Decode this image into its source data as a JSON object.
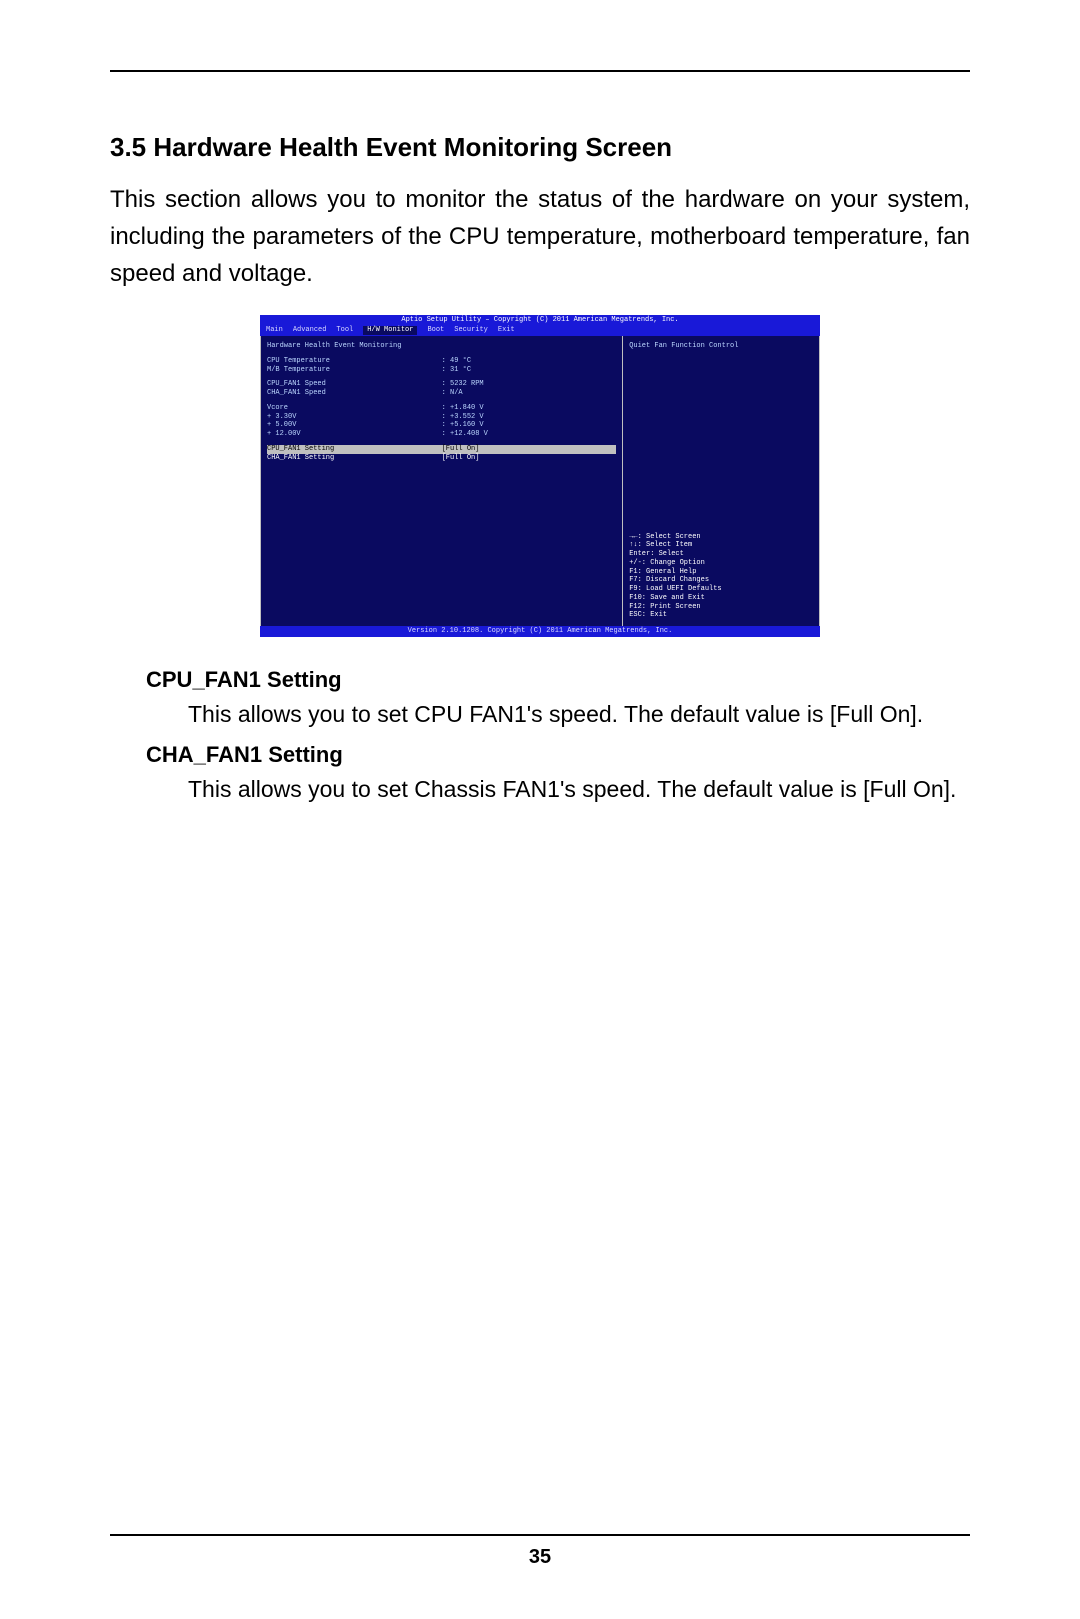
{
  "section_title": "3.5  Hardware Health Event Monitoring Screen",
  "intro": "This section allows you to monitor the status of the hardware on your system, including the parameters of the CPU temperature, motherboard temperature, fan speed and voltage.",
  "page_number": "35",
  "bios": {
    "titlebar": "Aptio Setup Utility – Copyright (C) 2011 American Megatrends, Inc.",
    "menus": [
      "Main",
      "Advanced",
      "Tool",
      "H/W Monitor",
      "Boot",
      "Security",
      "Exit"
    ],
    "menu_active_index": 3,
    "screen_header": "Hardware Health Event Monitoring",
    "rows": [
      {
        "label": "CPU Temperature",
        "value": ": 49 °C"
      },
      {
        "label": "M/B Temperature",
        "value": ": 31 °C"
      },
      {
        "gap": true
      },
      {
        "label": "CPU_FAN1 Speed",
        "value": ": 5232 RPM"
      },
      {
        "label": "CHA_FAN1 Speed",
        "value": ": N/A"
      },
      {
        "gap": true
      },
      {
        "label": "Vcore",
        "value": ": +1.840 V"
      },
      {
        "label": "+ 3.30V",
        "value": ": +3.552 V"
      },
      {
        "label": "+ 5.00V",
        "value": ": +5.160 V"
      },
      {
        "label": "+ 12.00V",
        "value": ": +12.408 V"
      },
      {
        "gap": true
      },
      {
        "label": "CPU_FAN1 Setting",
        "value": "[Full On]",
        "selected": true,
        "highlight": true
      },
      {
        "label": "CHA_FAN1 Setting",
        "value": "[Full On]",
        "selected": true
      }
    ],
    "help_top": "Quiet Fan Function Control",
    "keys": [
      "→←: Select Screen",
      "↑↓: Select Item",
      "Enter: Select",
      "+/-: Change Option",
      "F1: General Help",
      "F7: Discard Changes",
      "F9: Load UEFI Defaults",
      "F10: Save and Exit",
      "F12: Print Screen",
      "ESC: Exit"
    ],
    "footer": "Version 2.10.1208. Copyright (C) 2011 American Megatrends, Inc."
  },
  "items": [
    {
      "title": "CPU_FAN1 Setting",
      "body": "This allows you to set CPU FAN1's speed. The default value is [Full On]."
    },
    {
      "title": "CHA_FAN1 Setting",
      "body": "This allows you to set Chassis FAN1's speed. The default value is [Full On]."
    }
  ]
}
